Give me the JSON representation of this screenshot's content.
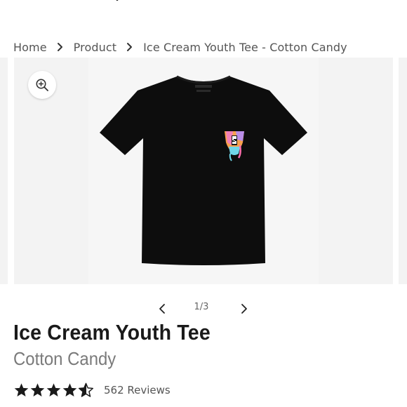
{
  "breadcrumb": {
    "items": [
      {
        "label": "Home"
      },
      {
        "label": "Product"
      },
      {
        "label": "Ice Cream Youth Tee - Cotton Candy"
      }
    ]
  },
  "gallery": {
    "current": "1",
    "total": "3",
    "counter": "1/3"
  },
  "product": {
    "title": "Ice Cream Youth Tee",
    "variant": "Cotton Candy",
    "rating": 4.5,
    "rating_max": 5,
    "reviews_label": "562 Reviews"
  },
  "icons": {
    "zoom": "zoom-in-icon",
    "prev": "chevron-left-icon",
    "next": "chevron-right-icon",
    "separator": "chevron-right-icon",
    "star": "star-icon"
  },
  "colors": {
    "shirt": "#0d0d0d",
    "background": "#f3f3f3",
    "text": "#1a1a1a",
    "muted": "#7a7a7a"
  }
}
